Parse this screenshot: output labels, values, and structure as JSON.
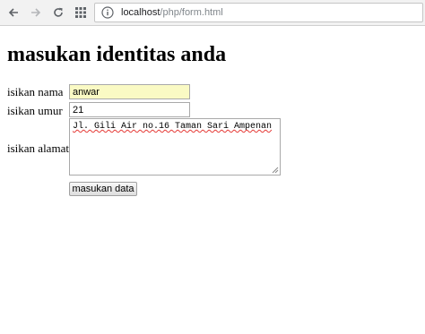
{
  "browser": {
    "url_host": "localhost",
    "url_path": "/php/form.html"
  },
  "page": {
    "heading": "masukan identitas anda"
  },
  "form": {
    "name_label": "isikan nama",
    "name_value": "anwar",
    "age_label": "isikan umur",
    "age_value": "21",
    "address_label": "isikan alamat",
    "address_value": "Jl. Gili Air no.16 Taman Sari Ampenan",
    "submit_label": "masukan data"
  },
  "colors": {
    "autofill_background": "#fafac4",
    "spellcheck_underline": "#e53935"
  }
}
